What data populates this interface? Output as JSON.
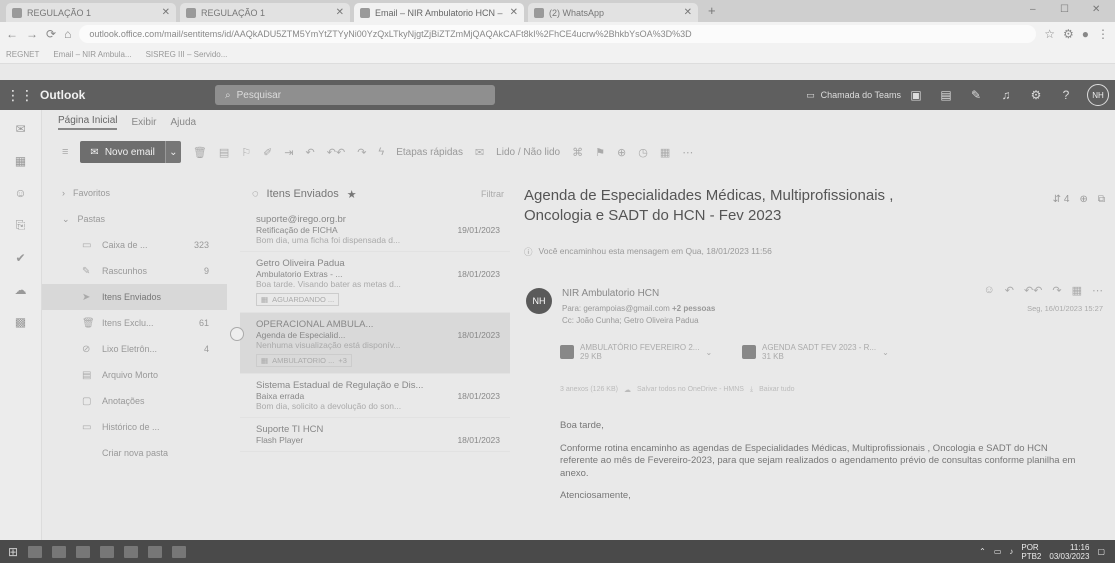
{
  "browser": {
    "tabs": [
      {
        "label": "REGULAÇÃO 1",
        "active": false
      },
      {
        "label": "REGULAÇÃO 1",
        "active": false
      },
      {
        "label": "Email – NIR Ambulatorio HCN – ",
        "active": true
      },
      {
        "label": "(2) WhatsApp",
        "active": false
      }
    ],
    "url": "outlook.office.com/mail/sentitems/id/AAQkADU5ZTM5YmYtZTYyNi00YzQxLTkyNjgtZjBiZTZmMjQAQAkCAFt8kI%2FhCE4ucrw%2BhkbYsOA%3D%3D",
    "bookmarks": [
      "REGNET",
      "Email – NIR Ambula...",
      "SISREG III – Servido..."
    ]
  },
  "header": {
    "app_name": "Outlook",
    "search_placeholder": "Pesquisar",
    "teams_call": "Chamada do Teams",
    "user_initials": "NH"
  },
  "ribbon": {
    "tabs": [
      "Página Inicial",
      "Exibir",
      "Ajuda"
    ],
    "new_mail": "Novo email",
    "quick_steps": "Etapas rápidas",
    "read_unread": "Lido / Não lido"
  },
  "folders": {
    "favorites": "Favoritos",
    "pastas": "Pastas",
    "items": [
      {
        "label": "Caixa de ...",
        "count": "323",
        "icon": "inbox-icon",
        "selected": false
      },
      {
        "label": "Rascunhos",
        "count": "9",
        "icon": "draft-icon",
        "selected": false
      },
      {
        "label": "Itens Enviados",
        "count": "",
        "icon": "send-icon",
        "selected": true
      },
      {
        "label": "Itens Exclu...",
        "count": "61",
        "icon": "trash-icon",
        "selected": false
      },
      {
        "label": "Lixo Eletrôn...",
        "count": "4",
        "icon": "junk-icon",
        "selected": false
      },
      {
        "label": "Arquivo Morto",
        "count": "",
        "icon": "archive-icon",
        "selected": false
      },
      {
        "label": "Anotações",
        "count": "",
        "icon": "notes-icon",
        "selected": false
      },
      {
        "label": "Histórico de ...",
        "count": "",
        "icon": "folder-icon",
        "selected": false
      }
    ],
    "new_folder": "Criar nova pasta"
  },
  "message_list": {
    "title": "Itens Enviados",
    "filter": "Filtrar",
    "messages": [
      {
        "from": "suporte@irego.org.br",
        "subject": "Retificação de FICHA",
        "date": "19/01/2023",
        "preview": "Bom dia, uma ficha foi dispensada d...",
        "attachment": "",
        "selected": false
      },
      {
        "from": "Getro Oliveira Padua",
        "subject": "Ambulatorio Extras - ...",
        "date": "18/01/2023",
        "preview": "Boa tarde. Visando bater as metas d...",
        "attachment": "AGUARDANDO ...",
        "selected": false
      },
      {
        "from": "OPERACIONAL AMBULA...",
        "subject": "Agenda de Especialid...",
        "date": "18/01/2023",
        "preview": "Nenhuma visualização está disponív...",
        "attachment": "AMBULATORIO ...",
        "extra": "+3",
        "selected": true
      },
      {
        "from": "Sistema Estadual de Regulação e Dis...",
        "subject": "Baixa errada",
        "date": "18/01/2023",
        "preview": "Bom dia, solicito a devolução do son...",
        "attachment": "",
        "selected": false
      },
      {
        "from": "Suporte TI HCN",
        "subject": "Flash Player",
        "date": "18/01/2023",
        "preview": "",
        "attachment": "",
        "selected": false
      }
    ]
  },
  "reading": {
    "subject": "Agenda de Especialidades Médicas, Multiprofissionais , Oncologia e SADT do HCN - Fev 2023",
    "count": "4",
    "forward_info": "Você encaminhou esta mensagem em Qua, 18/01/2023 11:56",
    "sender_initials": "NH",
    "sender": "NIR Ambulatorio HCN",
    "to_label": "Para:",
    "to": "gerampoias@gmail.com",
    "to_more": "+2 pessoas",
    "cc_label": "Cc:",
    "cc": "João Cunha; Getro Oliveira Padua",
    "date": "Seg, 16/01/2023 15:27",
    "attachments": [
      {
        "name": "AMBULATÓRIO FEVEREIRO 2...",
        "size": "29 KB"
      },
      {
        "name": "AGENDA SADT FEV 2023 - R...",
        "size": "31 KB"
      }
    ],
    "attachments_summary": "3 anexos (126 KB)",
    "save_onedrive": "Salvar todos no OneDrive - HMNS",
    "download_all": "Baixar tudo",
    "body": [
      "Boa tarde,",
      "Conforme rotina encaminho as agendas de Especialidades Médicas, Multiprofissionais , Oncologia e SADT do HCN referente ao mês de Fevereiro-2023, para que sejam realizados o agendamento prévio de consultas conforme planilha em anexo.",
      "Atenciosamente,"
    ]
  },
  "taskbar": {
    "lang": "POR",
    "lang2": "PTB2",
    "time": "11:16",
    "date": "03/03/2023"
  }
}
